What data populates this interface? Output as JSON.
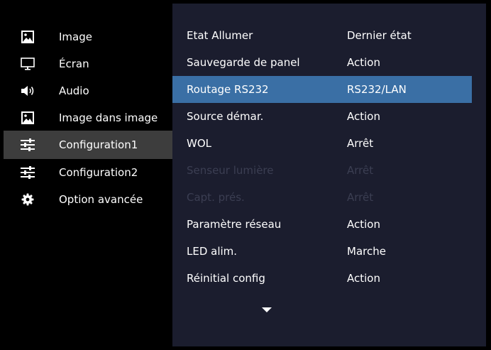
{
  "left_menu": {
    "items": [
      {
        "label": "Image",
        "icon": "image-icon"
      },
      {
        "label": "Écran",
        "icon": "monitor-icon"
      },
      {
        "label": "Audio",
        "icon": "speaker-icon"
      },
      {
        "label": "Image dans image",
        "icon": "pip-icon"
      },
      {
        "label": "Configuration1",
        "icon": "sliders-icon",
        "selected": true
      },
      {
        "label": "Configuration2",
        "icon": "sliders-icon"
      },
      {
        "label": "Option avancée",
        "icon": "gear-icon"
      }
    ]
  },
  "settings": {
    "rows": [
      {
        "label": "Etat Allumer",
        "value": "Dernier état"
      },
      {
        "label": "Sauvegarde de panel",
        "value": "Action"
      },
      {
        "label": "Routage RS232",
        "value": "RS232/LAN",
        "selected": true
      },
      {
        "label": "Source démar.",
        "value": "Action"
      },
      {
        "label": "WOL",
        "value": "Arrêt"
      },
      {
        "label": "Senseur lumière",
        "value": "Arrêt",
        "disabled": true
      },
      {
        "label": "Capt. prés.",
        "value": "Arrêt",
        "disabled": true
      },
      {
        "label": "Paramètre réseau",
        "value": "Action"
      },
      {
        "label": "LED alim.",
        "value": "Marche"
      },
      {
        "label": "Réinitial config",
        "value": "Action"
      }
    ],
    "scroll_indicator": "chevron-down-icon"
  },
  "colors": {
    "background": "#000000",
    "panel": "#1b1d2e",
    "left_selected": "#3d3d3d",
    "row_selected": "#3a6fa5",
    "disabled_text": "#3b3e52",
    "text": "#ffffff"
  }
}
